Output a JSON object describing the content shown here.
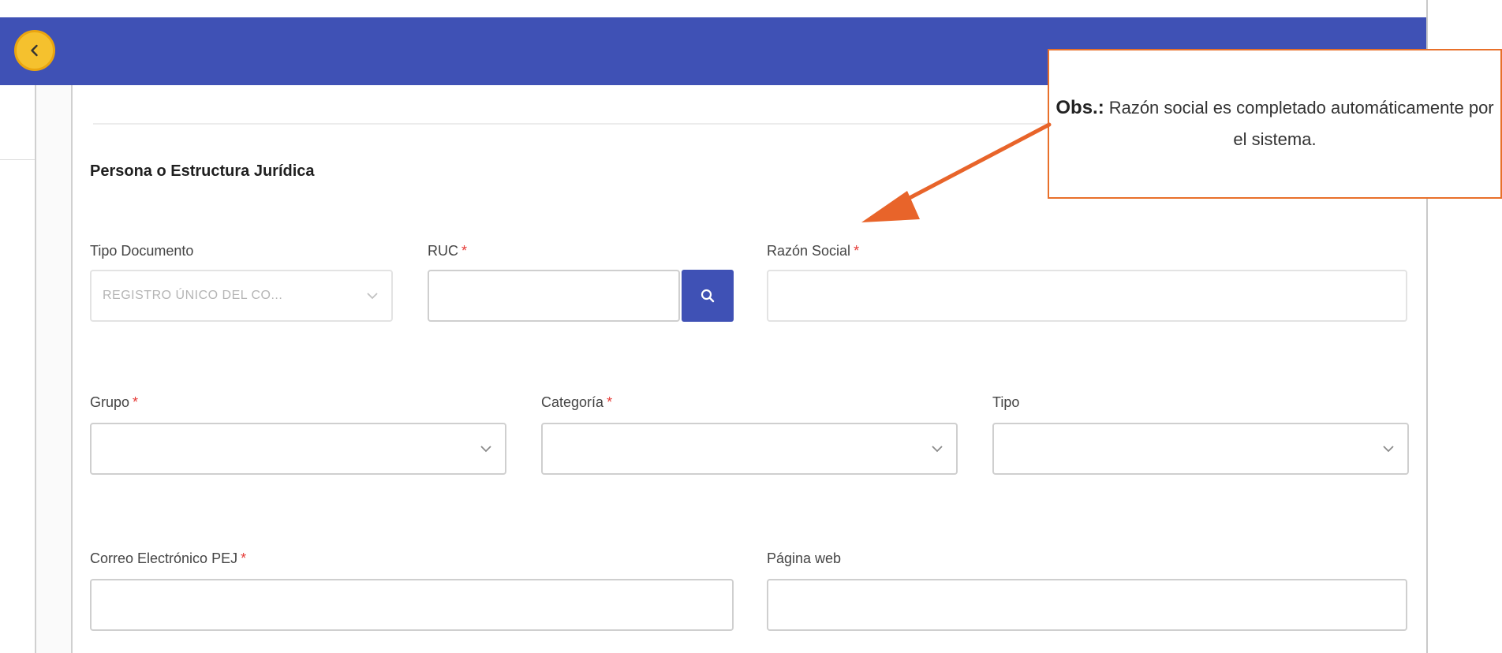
{
  "section_title": "Persona o Estructura Jurídica",
  "required_marker": "*",
  "fields": {
    "tipo_documento": {
      "label": "Tipo Documento",
      "value": "REGISTRO ÚNICO DEL CO..."
    },
    "ruc": {
      "label": "RUC",
      "value": ""
    },
    "razon_social": {
      "label": "Razón Social",
      "value": ""
    },
    "grupo": {
      "label": "Grupo",
      "value": ""
    },
    "categoria": {
      "label": "Categoría",
      "value": ""
    },
    "tipo": {
      "label": "Tipo",
      "value": ""
    },
    "correo": {
      "label": "Correo Electrónico PEJ",
      "value": ""
    },
    "pagina_web": {
      "label": "Página web",
      "value": ""
    }
  },
  "callout": {
    "prefix": "Obs.:",
    "text": "Razón social es completado automáticamente por el sistema."
  },
  "colors": {
    "header": "#3f51b5",
    "back_button": "#f5c12e",
    "callout_border": "#e8702a",
    "required": "#e53935"
  },
  "icons": [
    "chevron-left-icon",
    "search-icon",
    "chevron-down-icon"
  ]
}
